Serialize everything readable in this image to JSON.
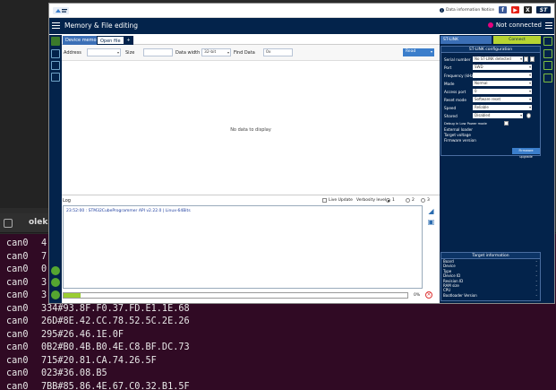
{
  "terminal": {
    "tab_title": "oleks",
    "lines": [
      {
        "ch": "can0",
        "data": "4"
      },
      {
        "ch": "can0",
        "data": "7"
      },
      {
        "ch": "can0",
        "data": "0"
      },
      {
        "ch": "can0",
        "data": "3"
      },
      {
        "ch": "can0",
        "data": "3"
      },
      {
        "ch": "can0",
        "data": "334#93.8F.F0.37.FD.E1.1E.68"
      },
      {
        "ch": "can0",
        "data": "26D#8E.42.CC.78.52.5C.2E.26"
      },
      {
        "ch": "can0",
        "data": "295#26.46.1E.0F"
      },
      {
        "ch": "can0",
        "data": "0B2#B0.4B.B0.4E.C8.BF.DC.73"
      },
      {
        "ch": "can0",
        "data": "715#20.81.CA.74.26.5F"
      },
      {
        "ch": "can0",
        "data": "023#36.08.B5"
      },
      {
        "ch": "can0",
        "data": "7BB#85.86.4E.67.C0.32.B1.5F"
      }
    ]
  },
  "topbar": {
    "info_label": "Data information Notice",
    "social": [
      {
        "icon": "facebook-icon",
        "glyph": "f",
        "color": "#3b5998"
      },
      {
        "icon": "youtube-icon",
        "glyph": "▶",
        "color": "#e62117"
      },
      {
        "icon": "x-icon",
        "glyph": "X",
        "color": "#222222"
      },
      {
        "icon": "st-logo-icon",
        "glyph": "ST",
        "color": "#03234b"
      }
    ]
  },
  "titlebar": {
    "title": "Memory & File editing",
    "connection_status": "Not connected",
    "status_color": "#e6007e"
  },
  "tabs": {
    "active": "Device memory",
    "open_file": "Open file",
    "add": "+"
  },
  "address_bar": {
    "address_label": "Address",
    "address_value": "",
    "size_label": "Size",
    "size_value": "",
    "data_width_label": "Data width",
    "data_width_value": "32-bit",
    "find_label": "Find Data",
    "find_value": "0x",
    "read_label": "Read"
  },
  "data_area": {
    "empty_message": "No data to display"
  },
  "log": {
    "label": "Log",
    "live_update": "Live Update",
    "verbosity_label": "Verbosity level",
    "levels": [
      "1",
      "2",
      "3"
    ],
    "selected_level": "1",
    "entry": "23:52:00 : STM32CubeProgrammer API v2.22.0 | Linux-64Bits",
    "progress_percent": "0%",
    "progress_value": 0.05
  },
  "right_panel": {
    "tab_a": "ST-LINK",
    "tab_b": "Connect",
    "config_title": "ST-LINK configuration",
    "fields": [
      {
        "label": "Serial number",
        "value": "No ST-LINK detected"
      },
      {
        "label": "Port",
        "value": "SWD"
      },
      {
        "label": "Frequency (kHz)",
        "value": ""
      },
      {
        "label": "Mode",
        "value": "Normal"
      },
      {
        "label": "Access port",
        "value": "0"
      },
      {
        "label": "Reset mode",
        "value": "Software reset"
      },
      {
        "label": "Speed",
        "value": "Reliable"
      },
      {
        "label": "Shared",
        "value": "Disabled"
      }
    ],
    "debug_low_power": "Debug in Low Power mode",
    "external_loader": "External loader",
    "target_voltage": "Target voltage",
    "firmware_version": "Firmware version",
    "firmware_upgrade": "Firmware upgrade",
    "target_title": "Target information",
    "target_rows": [
      "Board",
      "Device",
      "Type",
      "Device ID",
      "Revision ID",
      "RAM size",
      "CPU",
      "Bootloader Version"
    ],
    "target_placeholder": "-"
  }
}
